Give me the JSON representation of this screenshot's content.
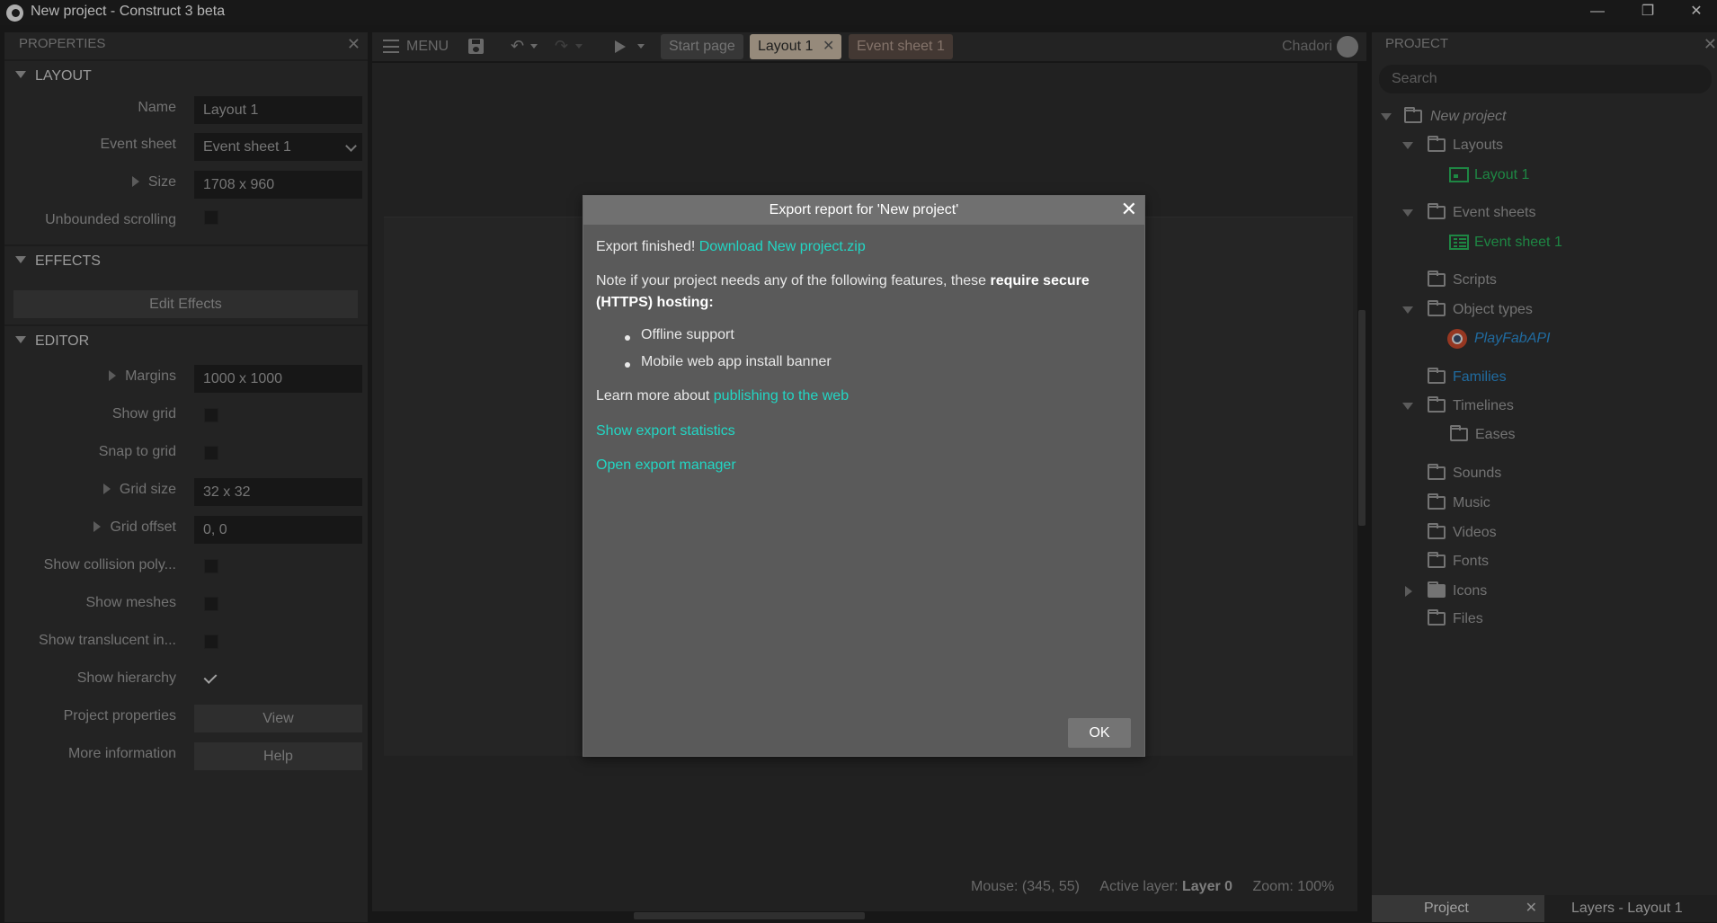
{
  "window": {
    "title": "New project - Construct 3 beta",
    "minimize": "—",
    "maximize": "❐",
    "close": "✕"
  },
  "properties": {
    "header": "PROPERTIES",
    "close_icon": "✕",
    "sections": {
      "layout": "LAYOUT",
      "effects": "EFFECTS",
      "editor": "EDITOR"
    },
    "rows": {
      "name_label": "Name",
      "name_value": "Layout 1",
      "event_sheet_label": "Event sheet",
      "event_sheet_value": "Event sheet 1",
      "size_label": "Size",
      "size_value": "1708 x 960",
      "unbounded_label": "Unbounded scrolling",
      "edit_effects": "Edit Effects",
      "margins_label": "Margins",
      "margins_value": "1000 x 1000",
      "show_grid_label": "Show grid",
      "snap_label": "Snap to grid",
      "grid_size_label": "Grid size",
      "grid_size_value": "32 x 32",
      "grid_offset_label": "Grid offset",
      "grid_offset_value": "0, 0",
      "collision_label": "Show collision poly...",
      "meshes_label": "Show meshes",
      "translucent_label": "Show translucent in...",
      "hierarchy_label": "Show hierarchy",
      "project_props_label": "Project properties",
      "project_props_btn": "View",
      "more_info_label": "More information",
      "more_info_btn": "Help"
    }
  },
  "toolbar": {
    "menu": "MENU",
    "tabs": [
      "Start page",
      "Layout 1",
      "Event sheet 1"
    ],
    "tab_close": "✕",
    "user": "Chadori"
  },
  "status": {
    "mouse": "Mouse: (345, 55)",
    "active_layer_label": "Active layer:",
    "active_layer_value": "Layer 0",
    "zoom": "Zoom: 100%"
  },
  "project": {
    "header": "PROJECT",
    "close_icon": "✕",
    "search_placeholder": "Search",
    "tree": {
      "root": "New project",
      "layouts": "Layouts",
      "layout1": "Layout 1",
      "event_sheets": "Event sheets",
      "event_sheet1": "Event sheet 1",
      "scripts": "Scripts",
      "object_types": "Object types",
      "playfab": "PlayFabAPI",
      "families": "Families",
      "timelines": "Timelines",
      "eases": "Eases",
      "sounds": "Sounds",
      "music": "Music",
      "videos": "Videos",
      "fonts": "Fonts",
      "icons": "Icons",
      "files": "Files"
    },
    "bottom_tabs": [
      "Project",
      "Layers - Layout 1"
    ]
  },
  "dialog": {
    "title": "Export report for 'New project'",
    "close_icon": "✕",
    "finished": "Export finished!",
    "download_link": "Download New project.zip",
    "note_prefix": "Note if your project needs any of the following features, these",
    "note_bold_1": "require secure",
    "note_bold_2": "(HTTPS) hosting:",
    "features": [
      "Offline support",
      "Mobile web app install banner"
    ],
    "learn_prefix": "Learn more about",
    "learn_link": "publishing to the web",
    "stats_link": "Show export statistics",
    "manager_link": "Open export manager",
    "ok": "OK"
  },
  "colors": {
    "accent_link": "#22d6c4",
    "tree_green": "#29b35a",
    "tree_blue": "#2b8fd6"
  }
}
